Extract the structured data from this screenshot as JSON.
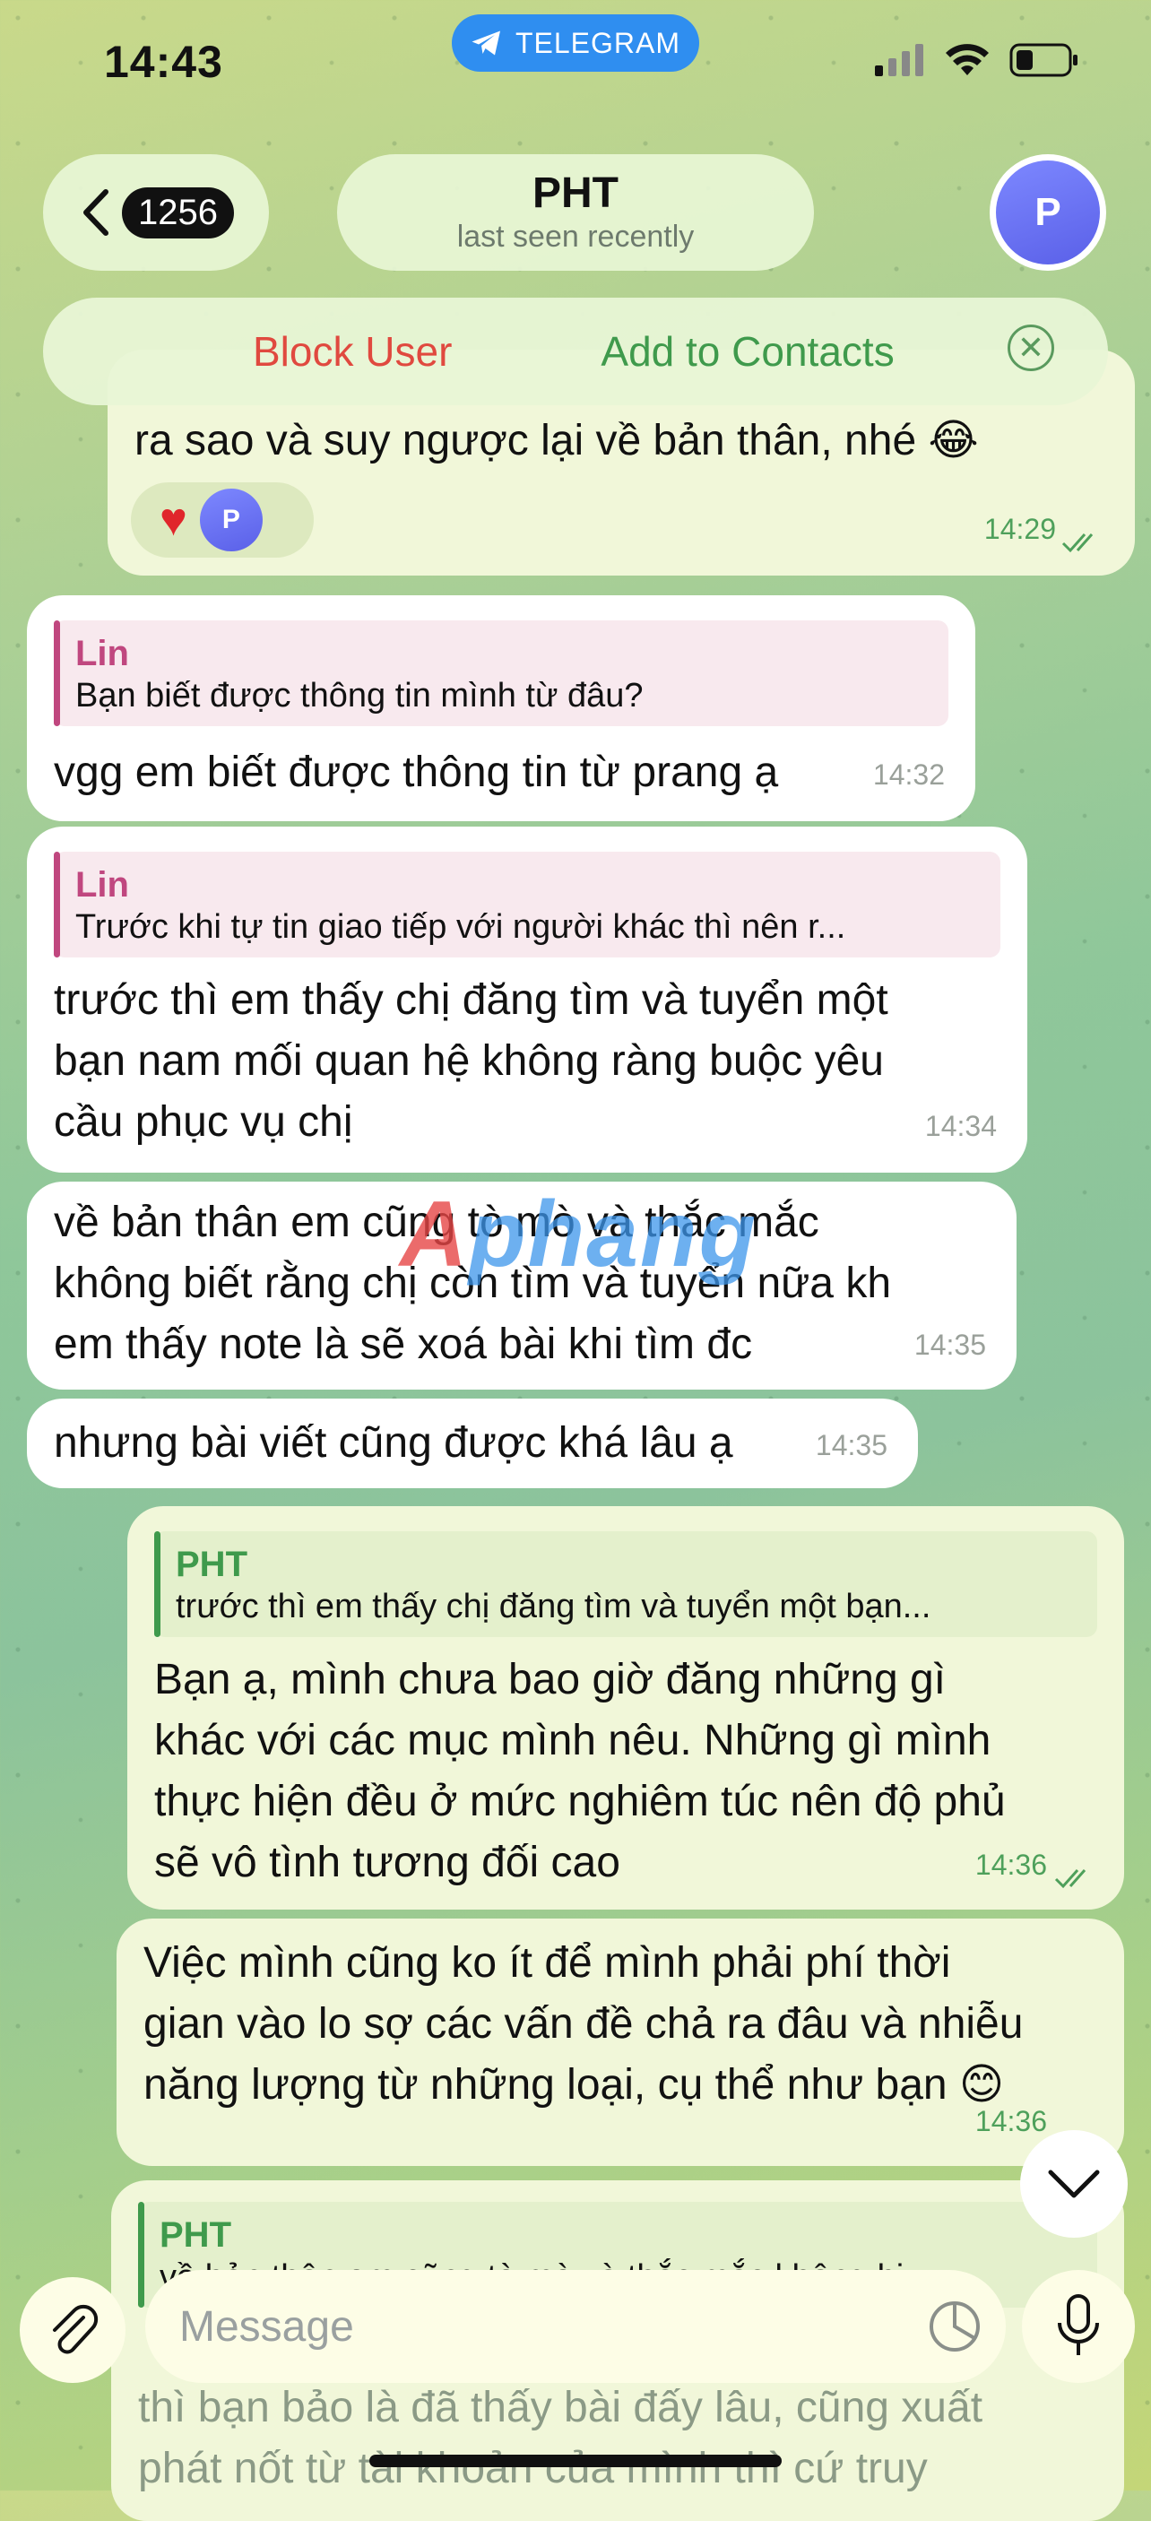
{
  "status_bar": {
    "time": "14:43",
    "telegram_label": "TELEGRAM"
  },
  "header": {
    "back_count": "1256",
    "name": "PHT",
    "status": "last seen recently",
    "avatar_initial": "P"
  },
  "action_bar": {
    "block_label": "Block User",
    "add_label": "Add to Contacts"
  },
  "messages": [
    {
      "dir": "out",
      "text": "ra sao và suy ngược lại về bản thân, nhé 😂",
      "time": "14:29",
      "reaction_avatar": "P"
    },
    {
      "dir": "in",
      "reply_name": "Lin",
      "reply_text": "Bạn biết được thông tin mình từ đâu?",
      "text": "vgg em biết được thông tin từ prang ạ",
      "time": "14:32"
    },
    {
      "dir": "in",
      "reply_name": "Lin",
      "reply_text": "Trước khi tự tin giao tiếp với người khác thì nên r...",
      "lines": [
        "trước thì em thấy chị đăng tìm và tuyển một",
        "bạn nam mối quan hệ không ràng buộc yêu",
        "cầu phục vụ chị"
      ],
      "time": "14:34"
    },
    {
      "dir": "in",
      "lines": [
        "về bản thân em cũng tò mò và thắc mắc",
        "không biết rằng chị còn tìm và tuyển nữa kh",
        "em thấy note là sẽ xoá bài khi tìm đc"
      ],
      "time": "14:35"
    },
    {
      "dir": "in",
      "text": "nhưng bài viết cũng được khá lâu ạ",
      "time": "14:35"
    },
    {
      "dir": "out",
      "reply_name": "PHT",
      "reply_text": "trước thì em thấy chị đăng tìm và tuyển một bạn...",
      "lines": [
        "Bạn ạ, mình chưa bao giờ đăng những gì",
        "khác với các mục mình nêu. Những gì mình",
        "thực hiện đều ở mức nghiêm túc nên độ phủ",
        "sẽ vô tình tương đối cao"
      ],
      "time": "14:36"
    },
    {
      "dir": "out",
      "lines": [
        "Việc mình cũng ko ít để mình phải phí thời",
        "gian vào lo sợ các vấn đề chả ra đâu và nhiễu",
        "năng lượng từ những loại, cụ thể như bạn 😊"
      ],
      "time": "14:36"
    },
    {
      "dir": "out",
      "reply_name": "PHT",
      "reply_text": "về bản thân em cũng tò mò và thắc mắc không bi...",
      "lines": [
        "thì bạn bảo là đã thấy bài đấy lâu, cũng xuất",
        "phát nốt từ tài khoản của mình thì cứ truy"
      ]
    }
  ],
  "watermark": {
    "prefix": "A",
    "rest": "phang"
  },
  "composer": {
    "placeholder": "Message"
  },
  "colors": {
    "accent_green": "#3f9a4c",
    "block_red": "#e0493f",
    "telegram_blue": "#2f8ef0",
    "reply_pink": "#c0477f"
  }
}
